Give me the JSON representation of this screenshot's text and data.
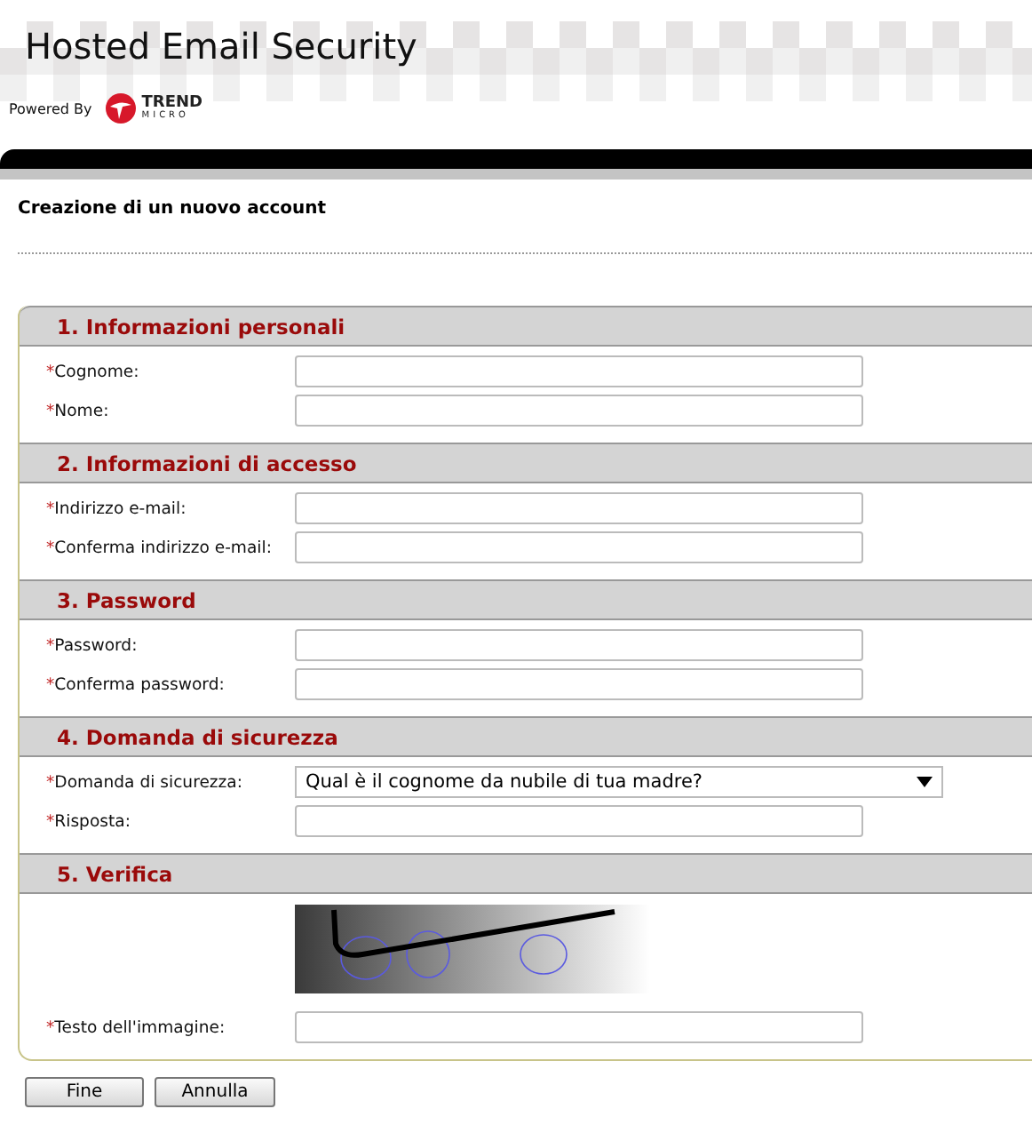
{
  "header": {
    "title": "Hosted Email Security",
    "powered_by": "Powered By",
    "logo_text": [
      "TREND",
      "MICRO"
    ]
  },
  "page_title": "Creazione di un nuovo account",
  "sections": [
    {
      "title": "1. Informazioni personali",
      "fields": [
        {
          "kind": "text",
          "mark": "*",
          "label": "Cognome:"
        },
        {
          "kind": "text",
          "mark": "*",
          "label": "Nome:"
        }
      ]
    },
    {
      "title": "2. Informazioni di accesso",
      "fields": [
        {
          "kind": "text",
          "mark": "*",
          "label": "Indirizzo e-mail:"
        },
        {
          "kind": "text",
          "mark": "*",
          "label": "Conferma indirizzo e-mail:"
        }
      ]
    },
    {
      "title": "3. Password",
      "fields": [
        {
          "kind": "text",
          "mark": "*",
          "label": "Password:"
        },
        {
          "kind": "text",
          "mark": "*",
          "label": "Conferma password:"
        }
      ]
    },
    {
      "title": "4. Domanda di sicurezza",
      "fields": [
        {
          "kind": "select",
          "mark": "*",
          "label": "Domanda di sicurezza:",
          "value": "Qual è il cognome da nubile di tua madre?"
        },
        {
          "kind": "text",
          "mark": "*",
          "label": "Risposta:"
        }
      ]
    },
    {
      "title": "5. Verifica",
      "fields": [
        {
          "kind": "captcha"
        },
        {
          "kind": "text",
          "mark": "*",
          "label": "Testo dell'immagine:"
        }
      ]
    }
  ],
  "buttons": [
    "Fine",
    "Annulla"
  ]
}
